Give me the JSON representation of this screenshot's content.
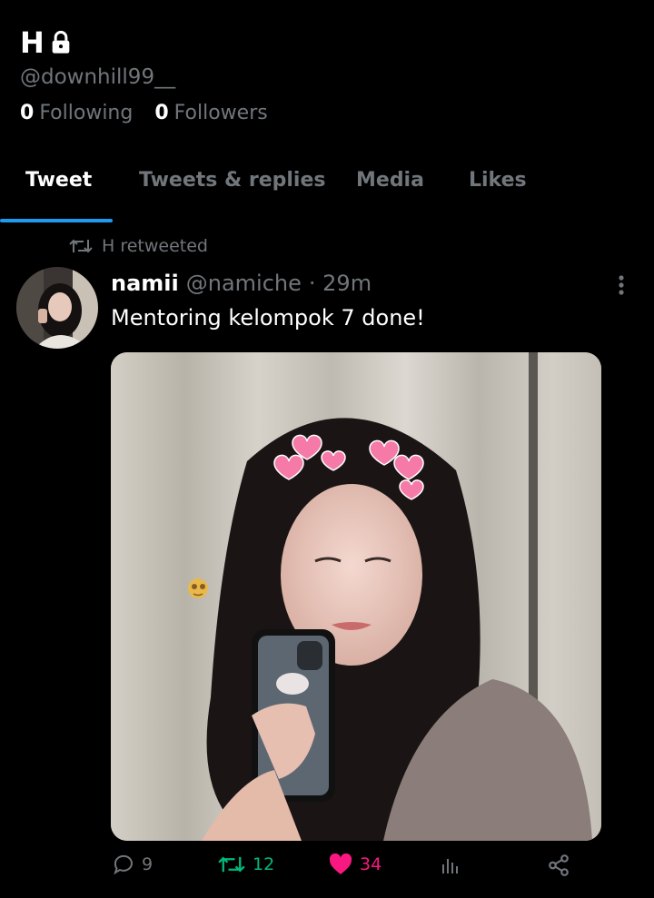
{
  "profile": {
    "name": "H",
    "handle": "@downhill99__",
    "following_count": "0",
    "following_label": "Following",
    "followers_count": "0",
    "followers_label": "Followers"
  },
  "tabs": [
    {
      "label": "Tweet",
      "active": true
    },
    {
      "label": "Tweets & replies",
      "active": false
    },
    {
      "label": "Media",
      "active": false
    },
    {
      "label": "Likes",
      "active": false
    }
  ],
  "tweet": {
    "retweeted_by": "H retweeted",
    "author_name": "namii",
    "author_handle": "@namiche",
    "time": "· 29m",
    "text": "Mentoring kelompok 7 done!",
    "image_emoji_text": "...",
    "replies": "9",
    "retweets": "12",
    "likes": "34"
  },
  "colors": {
    "accent": "#1d9bf0",
    "retweet_green": "#00ba7c",
    "like_pink": "#f91880",
    "muted": "#71767b"
  },
  "icons": [
    "lock-icon",
    "retweet-icon",
    "more-icon",
    "reply-icon",
    "like-icon",
    "views-icon",
    "share-icon"
  ]
}
